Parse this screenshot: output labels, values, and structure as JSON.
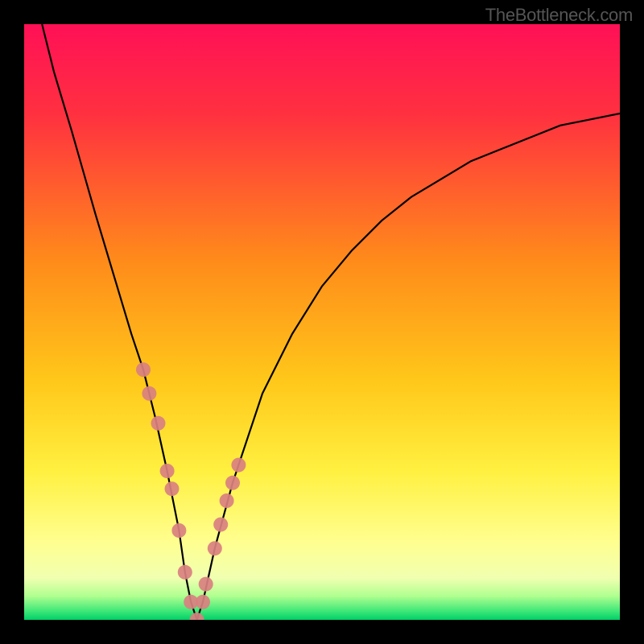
{
  "watermark": "TheBottleneck.com",
  "chart_data": {
    "type": "line",
    "title": "",
    "xlabel": "",
    "ylabel": "",
    "ylim": [
      0,
      100
    ],
    "xlim": [
      0,
      100
    ],
    "series": [
      {
        "name": "bottleneck-curve",
        "x": [
          3,
          5,
          8,
          10,
          12,
          15,
          18,
          20,
          22,
          24,
          25,
          26,
          27,
          28,
          29,
          30,
          32,
          35,
          40,
          45,
          50,
          55,
          60,
          65,
          70,
          75,
          80,
          85,
          90,
          95,
          100
        ],
        "y": [
          100,
          92,
          82,
          75,
          68,
          58,
          48,
          42,
          34,
          25,
          20,
          15,
          8,
          3,
          0,
          3,
          12,
          23,
          38,
          48,
          56,
          62,
          67,
          71,
          74,
          77,
          79,
          81,
          83,
          84,
          85
        ]
      }
    ],
    "markers": {
      "name": "highlight-points",
      "x": [
        20,
        21,
        22.5,
        24,
        24.8,
        26,
        27,
        28,
        29,
        30,
        30.5,
        32,
        33,
        34,
        35,
        36
      ],
      "y": [
        42,
        38,
        33,
        25,
        22,
        15,
        8,
        3,
        0,
        3,
        6,
        12,
        16,
        20,
        23,
        26
      ]
    },
    "background_gradient": {
      "top_color": "#ff1744",
      "mid1_color": "#ff8a00",
      "mid2_color": "#ffd600",
      "mid3_color": "#ffff66",
      "bottom_color": "#00e676"
    }
  }
}
